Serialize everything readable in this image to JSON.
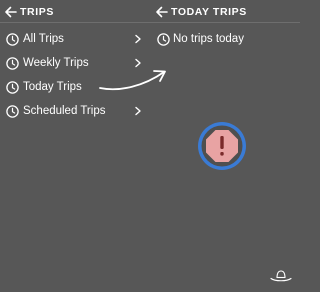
{
  "left_panel": {
    "title": "TRIPS",
    "items": [
      {
        "label": "All Trips",
        "icon": "clock-icon"
      },
      {
        "label": "Weekly Trips",
        "icon": "clock-icon"
      },
      {
        "label": "Today Trips",
        "icon": "clock-icon"
      },
      {
        "label": "Scheduled Trips",
        "icon": "clock-icon"
      }
    ]
  },
  "right_panel": {
    "title": "TODAY TRIPS",
    "empty_message": "No trips today"
  },
  "colors": {
    "background": "#575757",
    "text": "#ffffff",
    "alert_fill": "#e8a3a3",
    "alert_ring": "#3a7bd5",
    "alert_mark": "#7a2a2a"
  },
  "icons": {
    "back": "arrow-left-icon",
    "chevron": "chevron-right-icon",
    "alert": "alert-octagon-icon",
    "annotation": "curved-arrow-icon",
    "logo": "hat-logo-icon"
  }
}
